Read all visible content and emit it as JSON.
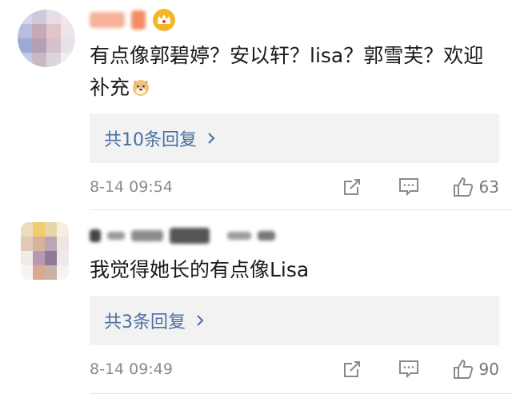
{
  "comments": [
    {
      "text": "有点像郭碧婷？安以轩？lisa？郭雪芙？欢迎补充",
      "reply_label": "共10条回复",
      "time": "8-14 09:54",
      "likes": "63",
      "badge_icon": "crown-icon",
      "emoji_icon": "doge-icon"
    },
    {
      "text": "我觉得她长的有点像Lisa",
      "reply_label": "共3条回复",
      "time": "8-14 09:49",
      "likes": "90"
    }
  ],
  "colors": {
    "link": "#4b6fa3",
    "meta": "#8a8a8a",
    "reply_bg": "#f2f2f2",
    "badge_gold": "#f3b629"
  }
}
